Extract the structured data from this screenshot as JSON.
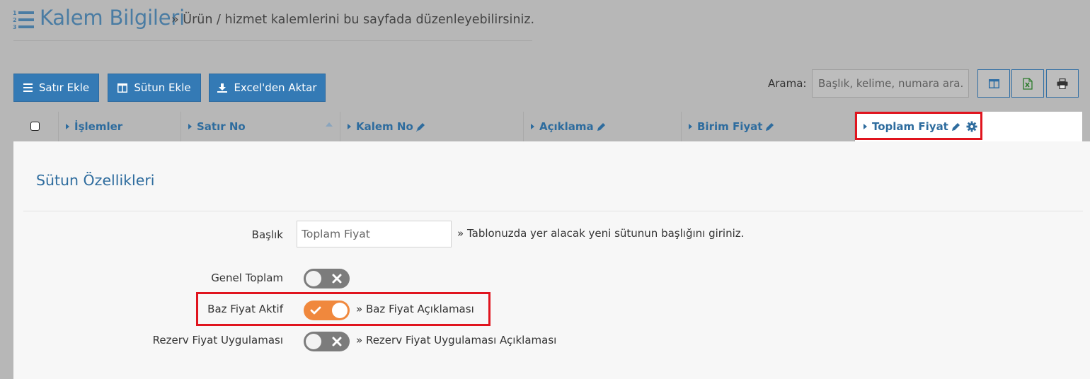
{
  "header": {
    "title": "Kalem Bilgileri",
    "subtitle": "» Ürün / hizmet kalemlerini bu sayfada düzenleyebilirsiniz."
  },
  "toolbar": {
    "add_row_label": "Satır Ekle",
    "add_column_label": "Sütun Ekle",
    "import_excel_label": "Excel'den Aktar",
    "search_label": "Arama:",
    "search_placeholder": "Başlık, kelime, numara ara..."
  },
  "table": {
    "columns": [
      {
        "label": "İşlemler"
      },
      {
        "label": "Satır No"
      },
      {
        "label": "Kalem No"
      },
      {
        "label": "Açıklama"
      },
      {
        "label": "Birim Fiyat"
      },
      {
        "label": "Toplam Fiyat"
      }
    ]
  },
  "column_settings": {
    "title": "Sütun Özellikleri",
    "fields": {
      "baslik": {
        "label": "Başlık",
        "value": "Toplam Fiyat",
        "hint": "» Tablonuzda yer alacak yeni sütunun başlığını giriniz."
      },
      "genel_toplam": {
        "label": "Genel Toplam",
        "enabled": false
      },
      "baz_fiyat": {
        "label": "Baz Fiyat Aktif",
        "enabled": true,
        "hint": "» Baz Fiyat Açıklaması"
      },
      "rezerv_fiyat": {
        "label": "Rezerv Fiyat Uygulaması",
        "enabled": false,
        "hint": "» Rezerv Fiyat Uygulaması Açıklaması"
      }
    }
  },
  "colors": {
    "accent": "#347ab5",
    "toggle_on": "#f0883d",
    "toggle_off": "#7c7c7c",
    "highlight": "#e0141e"
  }
}
